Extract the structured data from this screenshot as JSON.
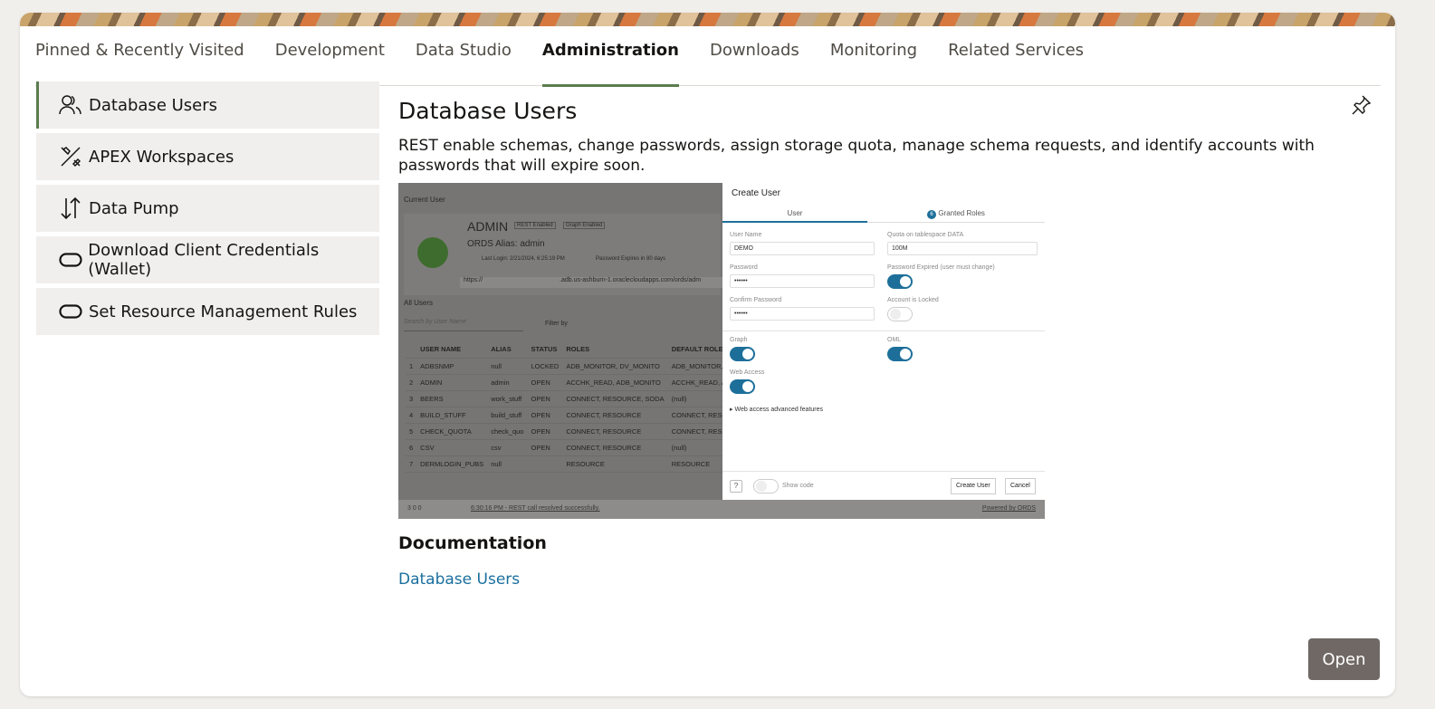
{
  "tabs": [
    "Pinned & Recently Visited",
    "Development",
    "Data Studio",
    "Administration",
    "Downloads",
    "Monitoring",
    "Related Services"
  ],
  "active_tab": "Administration",
  "sidebar": {
    "items": [
      {
        "label": "Database Users",
        "icon": "users-icon"
      },
      {
        "label": "APEX Workspaces",
        "icon": "apex-icon"
      },
      {
        "label": "Data Pump",
        "icon": "transfer-icon"
      },
      {
        "label": "Download Client Credentials (Wallet)",
        "icon": "pill-icon"
      },
      {
        "label": "Set Resource Management Rules",
        "icon": "pill-icon"
      }
    ]
  },
  "main": {
    "title": "Database Users",
    "description": "REST enable schemas, change passwords, assign storage quota, manage schema requests, and identify accounts with passwords that will expire soon.",
    "documentation_heading": "Documentation",
    "documentation_link": "Database Users",
    "open_button": "Open"
  },
  "screenshot": {
    "current_user_label": "Current User",
    "admin_name": "ADMIN",
    "badge_rest": "REST Enabled",
    "badge_graph": "Graph Enabled",
    "ords_alias": "ORDS Alias: admin",
    "last_login": "Last Login: 2/21/2024, 6:25:19 PM",
    "password_expires": "Password Expires in 80 days",
    "url_prefix": "https://",
    "url_suffix": ".adb.us-ashburn-1.oraclecloudapps.com/ords/adm",
    "all_users": "All Users",
    "search_placeholder": "Search by User Name",
    "filter_by": "Filter by",
    "columns": [
      "",
      "USER NAME",
      "ALIAS",
      "STATUS",
      "ROLES",
      "DEFAULT ROLES"
    ],
    "rows": [
      [
        "1",
        "ADBSNMP",
        "null",
        "LOCKED",
        "ADB_MONITOR, DV_MONITO",
        "ADB_MONITOR, D"
      ],
      [
        "2",
        "ADMIN",
        "admin",
        "OPEN",
        "ACCHK_READ, ADB_MONITO",
        "ACCHK_READ, AD"
      ],
      [
        "3",
        "BEERS",
        "work_stuff",
        "OPEN",
        "CONNECT, RESOURCE, SODA",
        "(null)"
      ],
      [
        "4",
        "BUILD_STUFF",
        "build_stuff",
        "OPEN",
        "CONNECT, RESOURCE",
        "CONNECT, RESOU"
      ],
      [
        "5",
        "CHECK_QUOTA",
        "check_quo",
        "OPEN",
        "CONNECT, RESOURCE",
        "CONNECT, RESOU"
      ],
      [
        "6",
        "CSV",
        "csv",
        "OPEN",
        "CONNECT, RESOURCE",
        "(null)"
      ],
      [
        "7",
        "DERMLOGIN_PUBS",
        "null",
        "",
        "RESOURCE",
        "RESOURCE"
      ]
    ],
    "dialog_title": "Create User",
    "dialog_tab_user": "User",
    "dialog_tab_roles": "Granted Roles",
    "dialog_roles_count": "6",
    "user_name_label": "User Name",
    "user_name_value": "DEMO",
    "quota_label": "Quota on tablespace DATA",
    "quota_value": "100M",
    "password_label": "Password",
    "password_value": "••••••",
    "password_expired_label": "Password Expired (user must change)",
    "confirm_password_label": "Confirm Password",
    "account_locked_label": "Account is Locked",
    "graph_label": "Graph",
    "oml_label": "OML",
    "web_access_label": "Web Access",
    "web_advanced": "Web access advanced features",
    "show_code": "Show code",
    "create_user_btn": "Create User",
    "cancel_btn": "Cancel",
    "status_text": "6:30:16 PM - REST call resolved successfully.",
    "powered_by": "Powered by ORDS",
    "status_counts": "3   0   0"
  },
  "colors": {
    "accent_green": "#5b7d4e",
    "link_blue": "#1a6f9e",
    "open_button": "#6f6865"
  }
}
